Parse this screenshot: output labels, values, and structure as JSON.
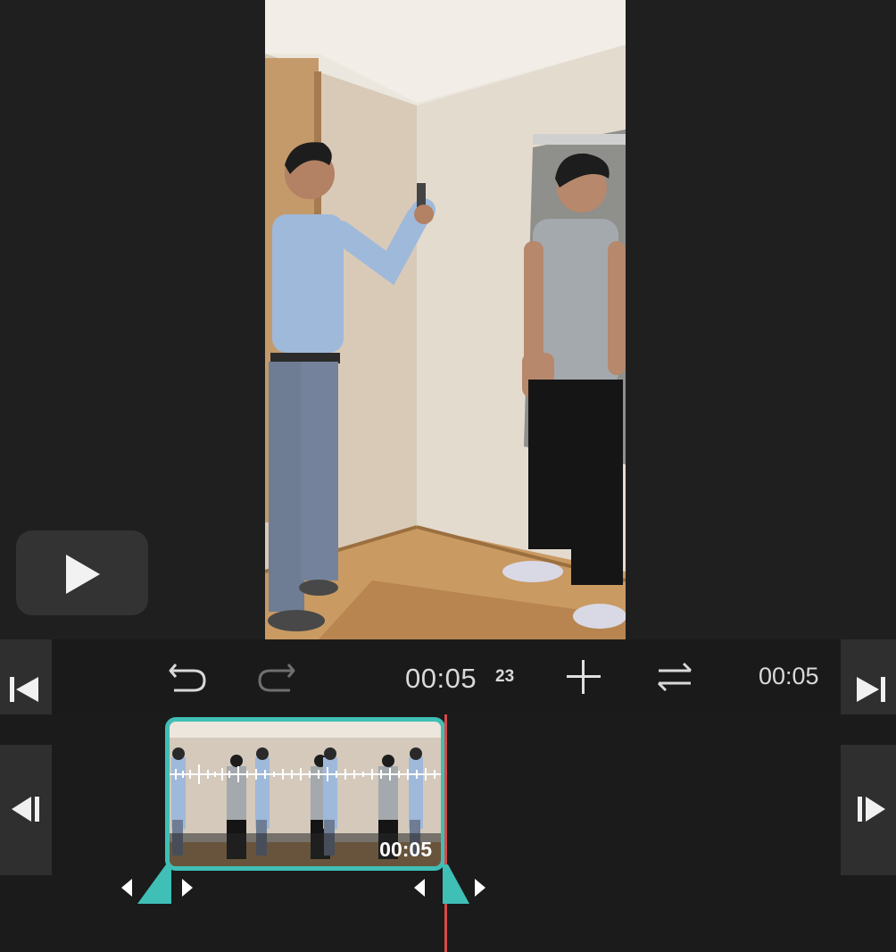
{
  "toolbar": {
    "current_time": "00:05",
    "current_frame": "23",
    "total_duration": "00:05",
    "undo_icon": "undo-icon",
    "redo_icon": "redo-icon",
    "add_icon": "plus-icon",
    "swap_icon": "swap-arrows-icon"
  },
  "preview": {
    "play_icon": "play-icon"
  },
  "side_nav": {
    "jump_start_icon": "skip-to-start-icon",
    "jump_end_icon": "skip-to-end-icon",
    "prev_frame_icon": "step-back-icon",
    "next_frame_icon": "step-forward-icon"
  },
  "timeline": {
    "clip_duration": "00:05"
  },
  "colors": {
    "accent": "#3fbfb6",
    "playhead": "#d64a4a",
    "background": "#1d1d1d",
    "button_bg": "#333333"
  }
}
